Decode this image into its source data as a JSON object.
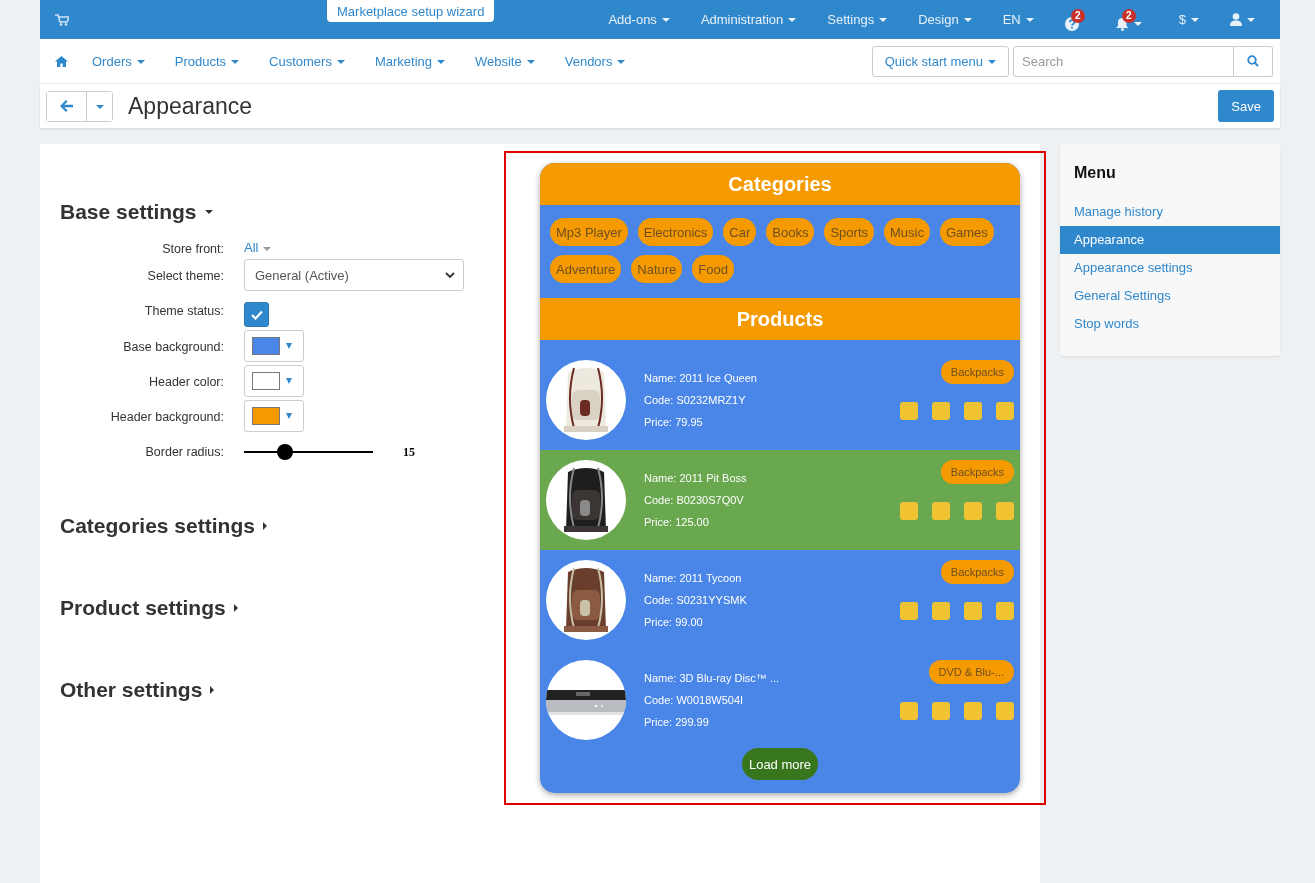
{
  "topbar": {
    "wizard_button": "Marketplace setup wizard",
    "menus": [
      {
        "label": "Add-ons"
      },
      {
        "label": "Administration"
      },
      {
        "label": "Settings"
      },
      {
        "label": "Design"
      },
      {
        "label": "EN"
      }
    ],
    "help": {
      "badge": "2"
    },
    "notifications": {
      "badge": "2"
    },
    "currency": "$"
  },
  "navbar": {
    "items": [
      "Orders",
      "Products",
      "Customers",
      "Marketing",
      "Website",
      "Vendors"
    ],
    "quick_start": "Quick start menu",
    "search": {
      "placeholder": "Search"
    }
  },
  "toolbar": {
    "title": "Appearance",
    "save": "Save"
  },
  "settings": {
    "sections": [
      {
        "title": "Base settings",
        "expanded": true,
        "fields": [
          {
            "kind": "link",
            "label": "Store front:",
            "value": "All"
          },
          {
            "kind": "select",
            "label": "Select theme:",
            "value": "General (Active)"
          },
          {
            "kind": "checkbox",
            "label": "Theme status:",
            "checked": true
          },
          {
            "kind": "color",
            "label": "Base background:",
            "color": "#4a86e8"
          },
          {
            "kind": "color",
            "label": "Header color:",
            "color": "#ffffff"
          },
          {
            "kind": "color",
            "label": "Header background:",
            "color": "#f59a00"
          },
          {
            "kind": "slider",
            "label": "Border radius:",
            "level": 0.32,
            "reading": "15"
          }
        ]
      },
      {
        "title": "Categories settings",
        "expanded": false
      },
      {
        "title": "Product settings",
        "expanded": false
      },
      {
        "title": "Other settings",
        "expanded": false
      }
    ]
  },
  "preview": {
    "categories_title": "Categories",
    "categories": [
      "Mp3 Player",
      "Electronics",
      "Car",
      "Books",
      "Sports",
      "Music",
      "Games",
      "Adventure",
      "Nature",
      "Food"
    ],
    "products_title": "Products",
    "products": [
      {
        "name": "Name: 2011 Ice Queen",
        "code": "Code: S0232MRZ1Y",
        "price": "Price: 79.95",
        "category": "Backpacks",
        "color": "#4a86e8",
        "stars": 4
      },
      {
        "name": "Name: 2011 Pit Boss",
        "code": "Code: B0230S7Q0V",
        "price": "Price: 125.00",
        "category": "Backpacks",
        "color": "#6aa84f",
        "stars": 4
      },
      {
        "name": "Name: 2011 Tycoon",
        "code": "Code: S0231YYSMK",
        "price": "Price: 99.00",
        "category": "Backpacks",
        "color": "#4a86e8",
        "stars": 4
      },
      {
        "name": "Name: 3D Blu-ray Disc™ ...",
        "code": "Code: W0018W504I",
        "price": "Price: 299.99",
        "category": "DVD & Blu-...",
        "color": "#4a86e8",
        "stars": 4
      }
    ],
    "load_more": "Load more"
  },
  "side_menu": {
    "title": "Menu",
    "items": [
      {
        "label": "Manage history",
        "selected": false
      },
      {
        "label": "Appearance",
        "selected": true
      },
      {
        "label": "Appearance settings",
        "selected": false
      },
      {
        "label": "General Settings",
        "selected": false
      },
      {
        "label": "Stop words",
        "selected": false
      }
    ]
  }
}
